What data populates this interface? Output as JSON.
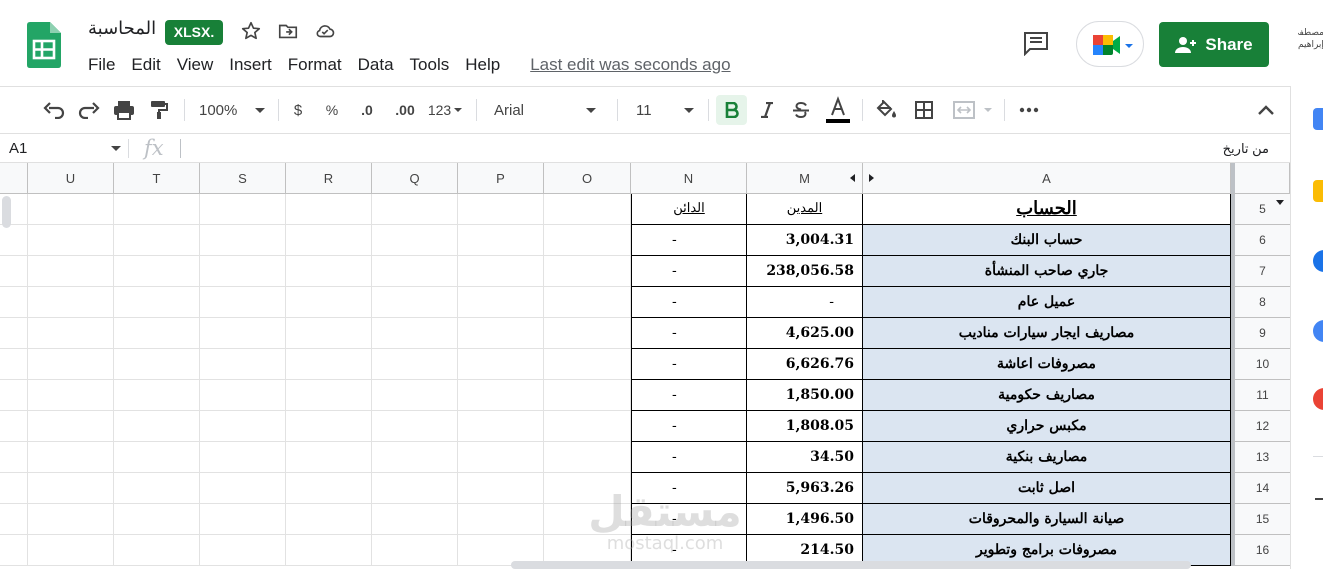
{
  "header": {
    "title": "المحاسبة",
    "file_badge": "XLSX.",
    "share_label": "Share",
    "account_line1": "مصطفى",
    "account_line2": "إبراهيم"
  },
  "menubar": {
    "items": [
      "File",
      "Edit",
      "View",
      "Insert",
      "Format",
      "Data",
      "Tools",
      "Help"
    ],
    "last_edit": "Last edit was seconds ago"
  },
  "toolbar": {
    "zoom": "100%",
    "currency": "$",
    "percent": "%",
    "decrease_decimal": ".0",
    "increase_decimal": ".00",
    "more_formats": "123",
    "font": "Arial",
    "font_size": "11"
  },
  "formula_bar": {
    "cell_ref": "A1",
    "fx": "fx",
    "content": "من تاريخ"
  },
  "columns": [
    "U",
    "T",
    "S",
    "R",
    "Q",
    "P",
    "O",
    "N",
    "M",
    "A"
  ],
  "table": {
    "header_row": "5",
    "header_account": "الحساب",
    "header_debit": "المدين",
    "header_credit": "الدائن",
    "rows": [
      {
        "num": "6",
        "account": "حساب البنك",
        "debit": "3,004.31",
        "credit": "-"
      },
      {
        "num": "7",
        "account": "جاري صاحب المنشأة",
        "debit": "238,056.58",
        "credit": "-"
      },
      {
        "num": "8",
        "account": "عميل عام",
        "debit": "-",
        "credit": "-"
      },
      {
        "num": "9",
        "account": "مصاريف ايجار سيارات مناديب",
        "debit": "4,625.00",
        "credit": "-"
      },
      {
        "num": "10",
        "account": "مصروفات اعاشة",
        "debit": "6,626.76",
        "credit": "-"
      },
      {
        "num": "11",
        "account": "مصاريف حكومية",
        "debit": "1,850.00",
        "credit": "-"
      },
      {
        "num": "12",
        "account": "مكبس حراري",
        "debit": "1,808.05",
        "credit": "-"
      },
      {
        "num": "13",
        "account": "مصاريف بنكية",
        "debit": "34.50",
        "credit": "-"
      },
      {
        "num": "14",
        "account": "اصل ثابت",
        "debit": "5,963.26",
        "credit": "-"
      },
      {
        "num": "15",
        "account": "صيانة السيارة والمحروقات",
        "debit": "1,496.50",
        "credit": "-"
      },
      {
        "num": "16",
        "account": "مصروفات برامج وتطوير",
        "debit": "214.50",
        "credit": "-"
      }
    ]
  },
  "watermark": {
    "main": "مستقل",
    "sub": "mostaql.com"
  },
  "colors": {
    "brand_green": "#188038",
    "account_fill": "#dbe5f1"
  }
}
